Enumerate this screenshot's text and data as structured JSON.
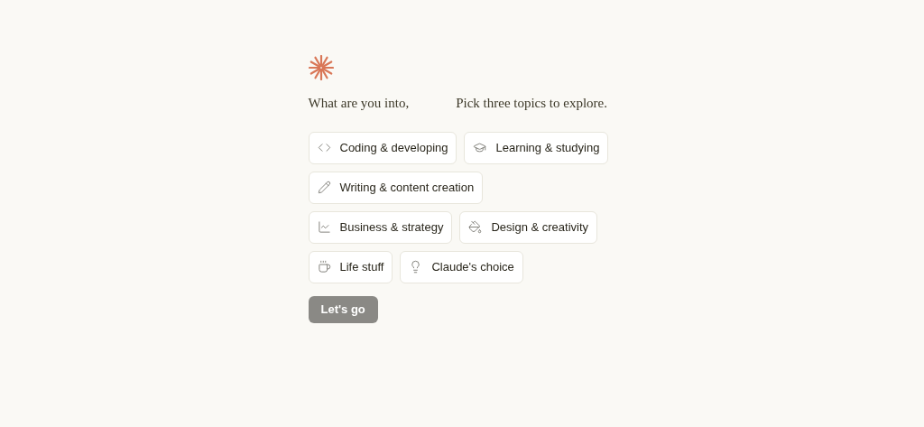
{
  "heading": {
    "greeting": "What are you into,",
    "prompt": "Pick three topics to explore."
  },
  "topic_rows": [
    [
      {
        "label": "Coding & developing",
        "kind": "code",
        "selected": false
      },
      {
        "label": "Learning & studying",
        "kind": "learning",
        "selected": false
      }
    ],
    [
      {
        "label": "Writing & content creation",
        "kind": "writing",
        "selected": false
      }
    ],
    [
      {
        "label": "Business & strategy",
        "kind": "business",
        "selected": false
      },
      {
        "label": "Design & creativity",
        "kind": "design",
        "selected": false
      }
    ],
    [
      {
        "label": "Life stuff",
        "kind": "life",
        "selected": false
      },
      {
        "label": "Claude's choice",
        "kind": "choice",
        "selected": false
      }
    ]
  ],
  "submit": {
    "label": "Let's go",
    "disabled": true
  }
}
